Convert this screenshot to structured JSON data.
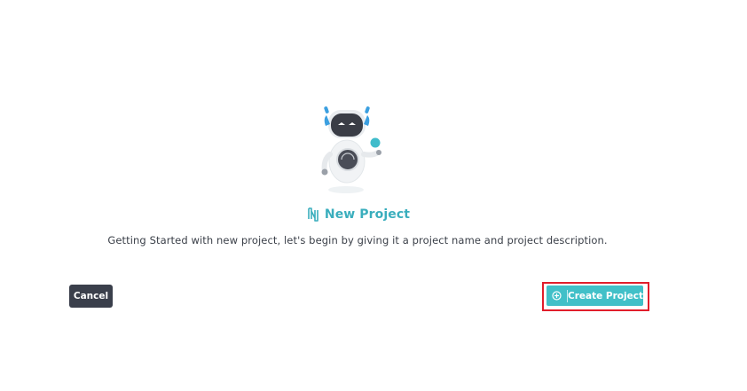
{
  "header": {
    "title": "New Project",
    "title_icon": "project-icon"
  },
  "intro": {
    "description": "Getting Started with new project, let's begin by giving it a project name and project description."
  },
  "mascot": {
    "icon": "robot-mascot-illustration"
  },
  "actions": {
    "cancel_label": "Cancel",
    "create_label": "Create Project",
    "create_icon": "plus-circle-icon"
  },
  "colors": {
    "accent": "#41c0c8",
    "title": "#3aaebd",
    "cancel_bg": "#3a3f4b",
    "highlight": "#e11d2b",
    "text": "#3a3f48"
  }
}
